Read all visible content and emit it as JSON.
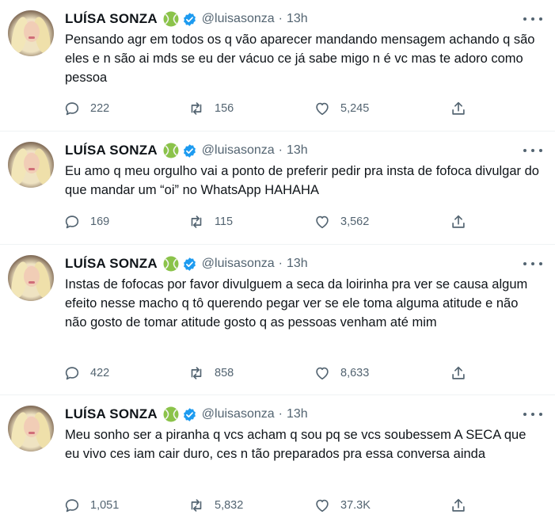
{
  "tweets": [
    {
      "name": "LUÍSA SONZA",
      "handle": "@luisasonza",
      "separator": "·",
      "time": "13h",
      "text": "Pensando agr em todos os q vão aparecer mandando mensagem achando q são eles e n são ai mds se eu der vácuo ce já sabe migo n é vc mas te adoro como pessoa",
      "replies": "222",
      "retweets": "156",
      "likes": "5,245"
    },
    {
      "name": "LUÍSA SONZA",
      "handle": "@luisasonza",
      "separator": "·",
      "time": "13h",
      "text": "Eu amo q meu orgulho vai a ponto de preferir pedir pra insta de fofoca divulgar do que mandar um “oi” no WhatsApp HAHAHA",
      "replies": "169",
      "retweets": "115",
      "likes": "3,562"
    },
    {
      "name": "LUÍSA SONZA",
      "handle": "@luisasonza",
      "separator": "·",
      "time": "13h",
      "text": "Instas de fofocas por favor divulguem a seca da loirinha pra ver se causa algum efeito nesse macho q tô querendo pegar ver se ele toma alguma atitude e não não gosto de tomar atitude gosto q as pessoas venham até mim",
      "replies": "422",
      "retweets": "858",
      "likes": "8,633"
    },
    {
      "name": "LUÍSA SONZA",
      "handle": "@luisasonza",
      "separator": "·",
      "time": "13h",
      "text": "Meu sonho ser a piranha q vcs acham q sou pq se vcs soubessem A SECA que eu vivo ces iam cair duro, ces n tão preparados pra essa conversa ainda",
      "replies": "1,051",
      "retweets": "5,832",
      "likes": "37.3K"
    }
  ],
  "icons": {
    "reply": "reply-icon",
    "retweet": "retweet-icon",
    "like": "like-icon",
    "share": "share-icon",
    "more": "more-icon",
    "verified": "verified-badge-icon",
    "emoji": "tennis-ball-icon"
  },
  "colors": {
    "text": "#0f1419",
    "secondary": "#536471",
    "verified": "#1d9bf0",
    "divider": "#eff3f4",
    "tennis": "#8bc34a"
  }
}
